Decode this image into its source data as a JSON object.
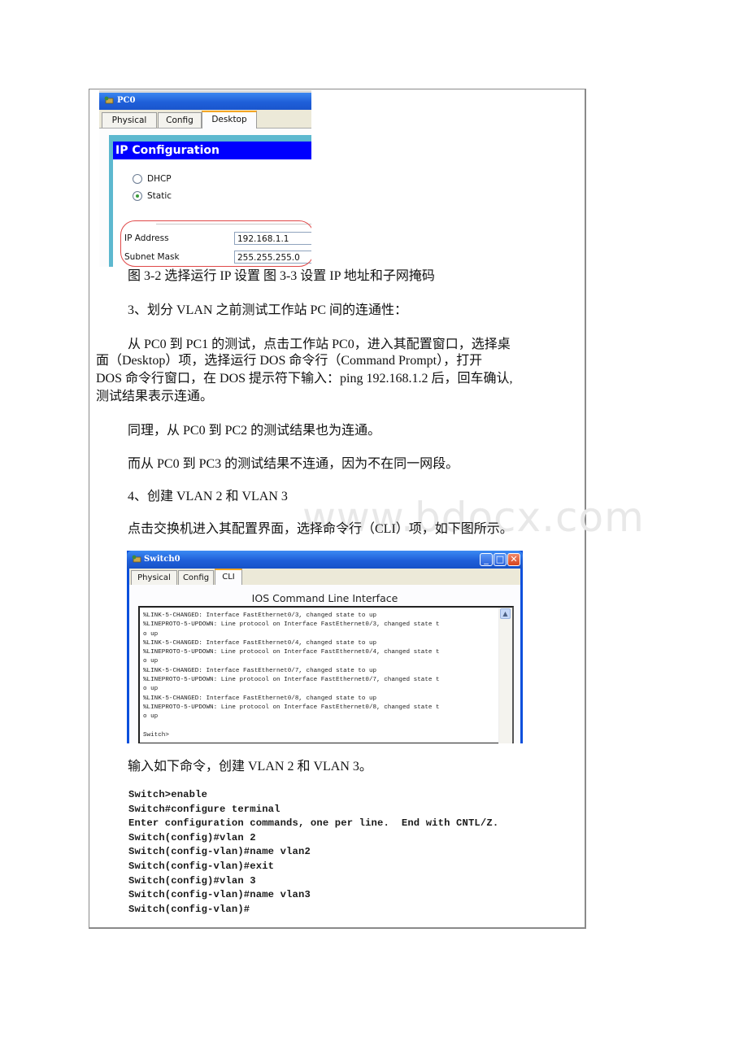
{
  "pc0_window": {
    "title": "PC0",
    "tabs": [
      {
        "label": "Physical",
        "active": false
      },
      {
        "label": "Config",
        "active": false
      },
      {
        "label": "Desktop",
        "active": true
      }
    ],
    "section_title": "IP Configuration",
    "options": [
      {
        "label": "DHCP",
        "selected": false
      },
      {
        "label": "Static",
        "selected": true
      }
    ],
    "fields": [
      {
        "label": "IP Address",
        "value": "192.168.1.1"
      },
      {
        "label": "Subnet Mask",
        "value": "255.255.255.0"
      }
    ],
    "highlight_color": "#e04848"
  },
  "doc": {
    "caption": "图 3-2 选择运行 IP 设置 图 3-3 设置 IP 地址和子网掩码",
    "step3_heading": "3、划分 VLAN 之前测试工作站 PC 间的连通性：",
    "step3_para_lines": [
      "从 PC0 到 PC1 的测试，点击工作站 PC0，进入其配置窗口，选择桌",
      "面（Desktop）项，选择运行 DOS 命令行（Command Prompt），打开",
      "DOS 命令行窗口，在 DOS 提示符下输入：ping 192.168.1.2 后，回车确认,",
      "测试结果表示连通。"
    ],
    "pc2_result": "同理，从 PC0 到 PC2 的测试结果也为连通。",
    "pc3_result": "而从 PC0 到 PC3 的测试结果不连通，因为不在同一网段。",
    "step4_heading": "4、创建 VLAN 2 和 VLAN 3",
    "step4_intro": "点击交换机进入其配置界面，选择命令行（CLI）项，如下图所示。",
    "commands_intro": "输入如下命令，创建 VLAN 2 和 VLAN 3。",
    "watermark": "www.bdocx.com"
  },
  "switch_window": {
    "title": "Switch0",
    "controls": {
      "minimize": "_",
      "maximize": "□",
      "close": "✕"
    },
    "tabs": [
      {
        "label": "Physical",
        "active": false
      },
      {
        "label": "Config",
        "active": false
      },
      {
        "label": "CLI",
        "active": true
      }
    ],
    "cli_title": "IOS Command Line Interface",
    "terminal_lines": [
      "%LINK-5-CHANGED: Interface FastEthernet0/3, changed state to up",
      "%LINEPROTO-5-UPDOWN: Line protocol on Interface FastEthernet0/3, changed state t",
      "o up",
      "%LINK-5-CHANGED: Interface FastEthernet0/4, changed state to up",
      "%LINEPROTO-5-UPDOWN: Line protocol on Interface FastEthernet0/4, changed state t",
      "o up",
      "%LINK-5-CHANGED: Interface FastEthernet0/7, changed state to up",
      "%LINEPROTO-5-UPDOWN: Line protocol on Interface FastEthernet0/7, changed state t",
      "o up",
      "%LINK-5-CHANGED: Interface FastEthernet0/8, changed state to up",
      "%LINEPROTO-5-UPDOWN: Line protocol on Interface FastEthernet0/8, changed state t",
      "o up",
      "",
      "Switch>"
    ],
    "scroll_up": "▲"
  },
  "commands": [
    "Switch>enable",
    "Switch#configure terminal",
    "Enter configuration commands, one per line.  End with CNTL/Z.",
    "Switch(config)#vlan 2",
    "Switch(config-vlan)#name vlan2",
    "Switch(config-vlan)#exit",
    "Switch(config)#vlan 3",
    "Switch(config-vlan)#name vlan3",
    "Switch(config-vlan)#"
  ]
}
